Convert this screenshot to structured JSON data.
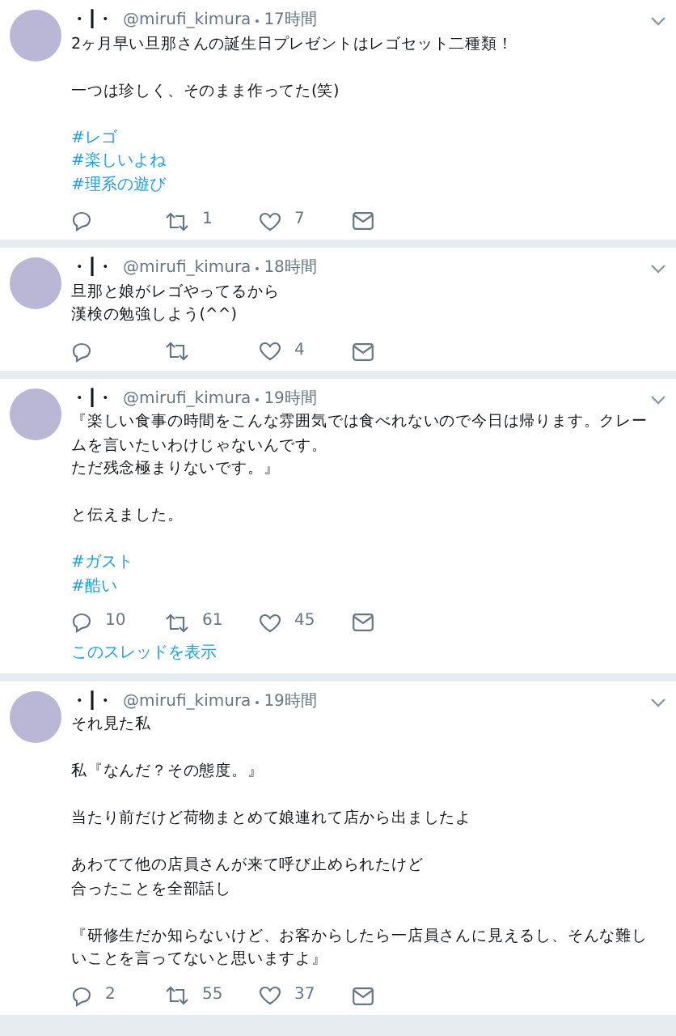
{
  "tweets": [
    {
      "name": "・┃・",
      "handle": "@mirufi_kimura",
      "time": "17時間",
      "paragraphs": [
        [
          "2ヶ月早い旦那さんの誕生日プレゼントはレゴセット二種類！"
        ],
        [
          "一つは珍しく、そのまま作ってた(笑)"
        ]
      ],
      "hashtags": [
        "#レゴ",
        "#楽しいよね",
        "#理系の遊び"
      ],
      "retweets": "1",
      "likes": "7"
    },
    {
      "name": "・┃・",
      "handle": "@mirufi_kimura",
      "time": "18時間",
      "paragraphs": [
        [
          "旦那と娘がレゴやってるから",
          "漢検の勉強しよう(^^)"
        ]
      ],
      "likes": "4"
    },
    {
      "name": "・┃・",
      "handle": "@mirufi_kimura",
      "time": "19時間",
      "paragraphs": [
        [
          "『楽しい食事の時間をこんな雰囲気では食べれないので今日は帰ります。クレー",
          "ムを言いたいわけじゃないんです。",
          "ただ残念極まりないです。』"
        ],
        [
          "と伝えました。"
        ]
      ],
      "hashtags": [
        "#ガスト",
        "#酷い"
      ],
      "replies": "10",
      "retweets": "61",
      "likes": "45",
      "thread_link": "このスレッドを表示"
    },
    {
      "name": "・┃・",
      "handle": "@mirufi_kimura",
      "time": "19時間",
      "paragraphs": [
        [
          "それ見た私"
        ],
        [
          "私『なんだ？その態度。』"
        ],
        [
          "当たり前だけど荷物まとめて娘連れて店から出ましたよ"
        ],
        [
          "あわてて他の店員さんが来て呼び止められたけど",
          "合ったことを全部話し"
        ],
        [
          "『研修生だか知らないけど、お客からしたら一店員さんに見えるし、そんな難し",
          "いことを言ってないと思いますよ』"
        ]
      ],
      "replies": "2",
      "retweets": "55",
      "likes": "37"
    }
  ]
}
